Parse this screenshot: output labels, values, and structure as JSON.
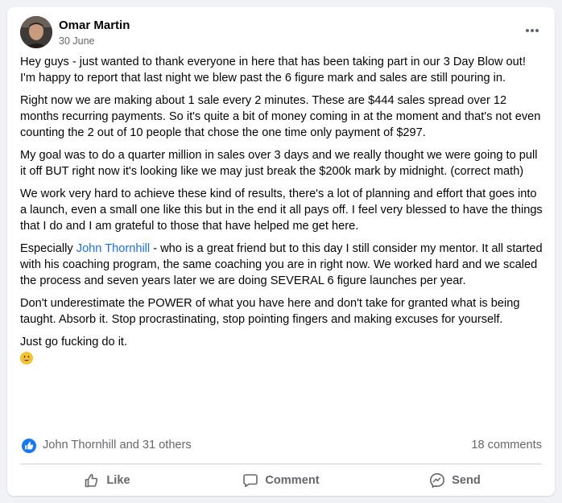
{
  "post": {
    "author": "Omar Martin",
    "date": "30 June",
    "paragraphs": {
      "p1": "Hey guys - just wanted to thank everyone in here that has been taking part in our 3 Day Blow out! I'm happy to report that last night we blew past the 6 figure mark and sales are still pouring in.",
      "p2": "Right now we are making about 1 sale every 2 minutes. These are $444 sales spread over 12 months recurring payments. So it's quite a bit of money coming in at the moment and that's not even counting the 2 out of 10 people that chose the one time only payment of $297.",
      "p3": "My goal was to do a quarter million in sales over 3 days and we really thought we were going to pull it off BUT right now it's looking like we may just break the $200k mark by midnight. (correct math)",
      "p4": "We work very hard to achieve these kind of results, there's a lot of planning and effort that goes into a launch, even a small one like this but in the end it all pays off. I feel very blessed to have the things that I do and I am grateful to those that have helped me get here.",
      "p5_prefix": "Especially ",
      "p5_mention": "John Thornhill",
      "p5_suffix": " - who is a great friend but to this day I still consider my mentor. It all started with his coaching program, the same coaching you are in right now. We worked hard and we scaled the process and seven years later we are doing SEVERAL 6 figure launches per year.",
      "p6": "Don't underestimate the POWER of what you have here and don't take for granted what is being taught. Absorb it. Stop procrastinating, stop pointing fingers and making excuses for yourself.",
      "p7": "Just go fucking do it."
    }
  },
  "reactions": {
    "summary": "John Thornhill and 31 others",
    "comments": "18 comments",
    "icon": "like-icon"
  },
  "actions": {
    "like_label": "Like",
    "comment_label": "Comment",
    "send_label": "Send"
  },
  "colors": {
    "accent": "#216fdb",
    "like_badge": "#1877f2",
    "muted_text": "#65676b"
  }
}
